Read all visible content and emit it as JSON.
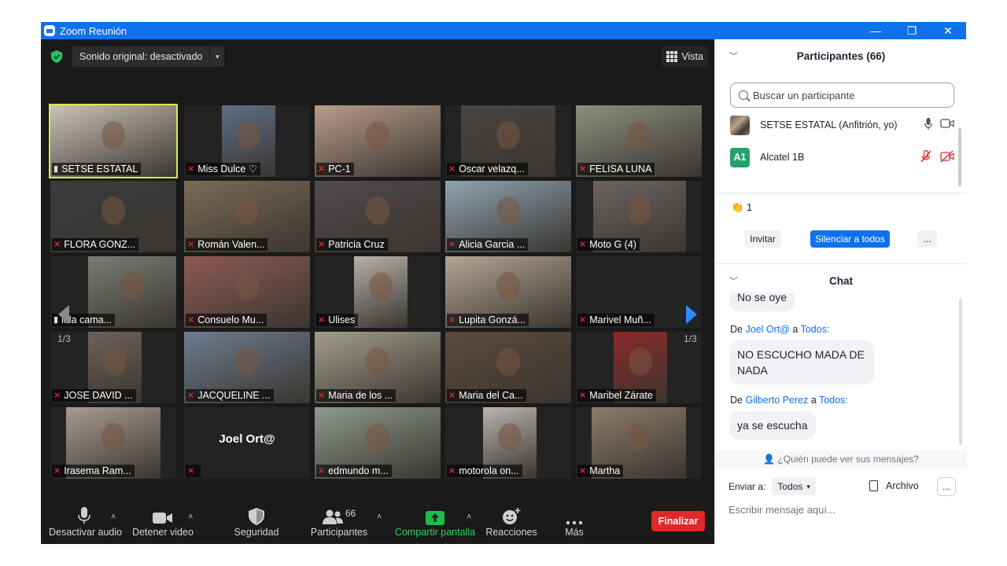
{
  "window": {
    "title": "Zoom Reunión",
    "minimize": "—",
    "restore": "❐",
    "close": "✕"
  },
  "topbar": {
    "sonido": "Sonido original: desactivado",
    "sonido_arrow": "▾",
    "vista": "Vista"
  },
  "pager": {
    "left": "1/3",
    "right": "1/3"
  },
  "tiles": [
    {
      "name": "SETSE ESTATAL",
      "muted": false,
      "active": true,
      "bg": "#c9c2b8"
    },
    {
      "name": "Miss Dulce ♡",
      "muted": true,
      "bg": "#5d6f86"
    },
    {
      "name": "PC-1",
      "muted": true,
      "bg": "#b89c8a"
    },
    {
      "name": "Oscar velazq...",
      "muted": true,
      "bg": "#4a4440"
    },
    {
      "name": "FELISA LUNA",
      "muted": true,
      "bg": "#8c8e7e"
    },
    {
      "name": "FLORA GONZ...",
      "muted": true,
      "bg": "#3a3b3c"
    },
    {
      "name": "Román Valen...",
      "muted": true,
      "bg": "#7a6b56"
    },
    {
      "name": "Patricia Cruz",
      "muted": true,
      "bg": "#4f4a4c"
    },
    {
      "name": "Alicia Garcia ...",
      "muted": true,
      "bg": "#8fa3b0"
    },
    {
      "name": "Moto G (4)",
      "muted": true,
      "bg": "#6b6460"
    },
    {
      "name": "iela cama...",
      "muted": false,
      "bg": "#7a7d74"
    },
    {
      "name": "Consuelo Mu...",
      "muted": true,
      "bg": "#8f5a55"
    },
    {
      "name": "Ulises",
      "muted": true,
      "bg": "#b7b0a9"
    },
    {
      "name": "Lupita Gonzá...",
      "muted": true,
      "bg": "#b4a594"
    },
    {
      "name": "Marivel Muñ...",
      "muted": true,
      "bg": "#232323"
    },
    {
      "name": "JOSE DAVID ...",
      "muted": true,
      "bg": "#6c6259"
    },
    {
      "name": "JACQUELINE ...",
      "muted": true,
      "bg": "#6d7c8e"
    },
    {
      "name": "Maria de los ...",
      "muted": true,
      "bg": "#a29d8d"
    },
    {
      "name": "Maria del Ca...",
      "muted": true,
      "bg": "#5a4a3d"
    },
    {
      "name": "Maribel Zárate",
      "muted": true,
      "bg": "#8a2a2a"
    },
    {
      "name": "Irasema Ram...",
      "muted": true,
      "bg": "#a79b92"
    },
    {
      "name": "",
      "muted": true,
      "bg": "#232323",
      "big": "Joel Ort@"
    },
    {
      "name": "edmundo m...",
      "muted": true,
      "bg": "#8d9a8c"
    },
    {
      "name": "motorola on...",
      "muted": true,
      "bg": "#b9b3ad"
    },
    {
      "name": "Martha",
      "muted": true,
      "bg": "#8c7c6a"
    }
  ],
  "toolbar": {
    "audio": "Desactivar audio",
    "video": "Detener video",
    "security": "Seguridad",
    "participants": "Participantes",
    "participants_count": "66",
    "share": "Compartir pantalla",
    "reactions": "Reacciones",
    "more": "Más",
    "end": "Finalizar"
  },
  "panel": {
    "participants_title": "Participantes (66)",
    "search_placeholder": "Buscar un participante",
    "participants": [
      {
        "name": "SETSE ESTATAL (Anfitrión, yo)",
        "avatar": ""
      },
      {
        "name": "Alcatel 1B",
        "avatar": "A1"
      }
    ],
    "clap_count": "1",
    "invite": "Invitar",
    "mute_all": "Silenciar a todos",
    "more": "...",
    "chat_title": "Chat",
    "chat": [
      {
        "text": "No se oye"
      },
      {
        "prefix": "De",
        "from": "Joel Ort@",
        "mid": "a",
        "to": "Todos:",
        "text": "NO ESCUCHO MADA DE NADA"
      },
      {
        "prefix": "De",
        "from": "Gilberto Perez",
        "mid": "a",
        "to": "Todos:",
        "text": "ya se escucha"
      }
    ],
    "who_can_see": "¿Quién puede ver sus mensajes?",
    "send_to_label": "Enviar a:",
    "send_to_value": "Todos",
    "file": "Archivo",
    "input_placeholder": "Escribir mensaje aquí..."
  }
}
